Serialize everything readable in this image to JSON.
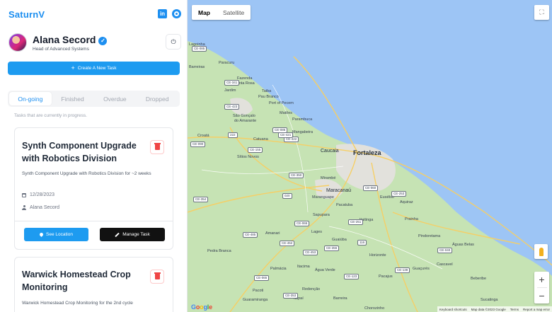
{
  "app": {
    "brand": "SaturnV"
  },
  "header": {
    "linkedin_icon": "linkedin-icon",
    "github_icon": "github-icon"
  },
  "profile": {
    "name": "Alana Secord",
    "role": "Head of Advanced Systems",
    "verified_icon": "verified-check-icon",
    "power_icon": "power-icon",
    "power_glyph": "⏻"
  },
  "actions": {
    "create_label": "Create A New Task",
    "create_glyph": "+"
  },
  "tabs": [
    {
      "label": "On-going",
      "active": true
    },
    {
      "label": "Finished",
      "active": false
    },
    {
      "label": "Overdue",
      "active": false
    },
    {
      "label": "Dropped",
      "active": false
    }
  ],
  "tab_description": "Tasks that are currently in progress.",
  "tasks": [
    {
      "title": "Synth Component Upgrade with Robotics Division",
      "description": "Synth Component Upgrade with Robotics Division for ~2 weeks",
      "date": "12/28/2023",
      "assignee": "Alana Secord",
      "see_location_label": "See Location",
      "manage_label": "Manage Task"
    },
    {
      "title": "Warwick Homestead Crop Monitoring",
      "description": "Warwick Homestead Crop Monitoring for the 2nd cycle"
    }
  ],
  "map": {
    "type_control": {
      "map_label": "Map",
      "satellite_label": "Satellite",
      "selected": "Map"
    },
    "fullscreen_glyph": "⛶",
    "zoom_in_glyph": "+",
    "zoom_out_glyph": "−",
    "logo_text": "Google",
    "attribution": {
      "shortcuts": "Keyboard shortcuts",
      "data": "Map data ©2023 Google",
      "terms": "Terms",
      "report": "Report a map error"
    },
    "colors": {
      "water": "#9dc5f5",
      "land": "#c6e3b4",
      "urban": "#e2e1dc",
      "road": "#f6cf65"
    },
    "places": {
      "fortaleza": "Fortaleza",
      "caucaia": "Caucaia",
      "maracanau": "Maracanaú",
      "paracuru": "Paracuru",
      "lagoinha": "Lagoinha",
      "barreiras": "Barreiras",
      "fazenda": "Fazenda",
      "santa_rosa": "Santa Rosa",
      "jardim": "Jardim",
      "taiba": "Taiba",
      "pau_branco": "Pau Branco",
      "port_pecem": "Port of Pecem",
      "sao_goncalo": "São Gonçalo",
      "do_amarante": "do Amarante",
      "matoes": "Matões",
      "parambuca": "Parambuca",
      "croata": "Croatá",
      "catuana": "Catuana",
      "mangabeira": "Mangabeira",
      "sitios_novos": "Sítios Novos",
      "mirambe": "Mirambé",
      "maranguape": "Maranguape",
      "pacatuba": "Pacatuba",
      "eusebio": "Eusébio",
      "aquiraz": "Aquiraz",
      "sapupara": "Sapupara",
      "itaitinga": "Itaitinga",
      "prainha": "Prainha",
      "pindoretama": "Pindoretama",
      "aguas_belas": "Águas Belas",
      "lages": "Lages",
      "amanari": "Amanari",
      "guaiuba": "Guaiúba",
      "horizonte": "Horizonte",
      "cascavel": "Cascavel",
      "pedra_branca": "Pedra Branca",
      "palmacia": "Palmácia",
      "itacima": "Itacima",
      "agua_verde": "Água Verde",
      "pacajus": "Pacajus",
      "guacures": "Guaçurés",
      "beberibe": "Beberibe",
      "pacoti": "Pacoti",
      "redencao": "Redenção",
      "guaramiranga": "Guaramiranga",
      "itapai": "Itapaí",
      "barreira": "Barreira",
      "chorozinho": "Chorozinho",
      "sucatinga": "Sucatinga"
    },
    "shields": [
      "CE-085",
      "CE-341",
      "CE-423",
      "CE-422",
      "CE-090",
      "CE-155",
      "CE-085",
      "CE-421",
      "222",
      "CE-350",
      "020",
      "CE-060",
      "CE-253",
      "CE-065",
      "CE-485",
      "CE-354",
      "116",
      "CE-452",
      "CE-453",
      "CE-356",
      "CE-251",
      "CE-040",
      "CE-065",
      "CE-353",
      "CE-138",
      "CE-123"
    ]
  }
}
